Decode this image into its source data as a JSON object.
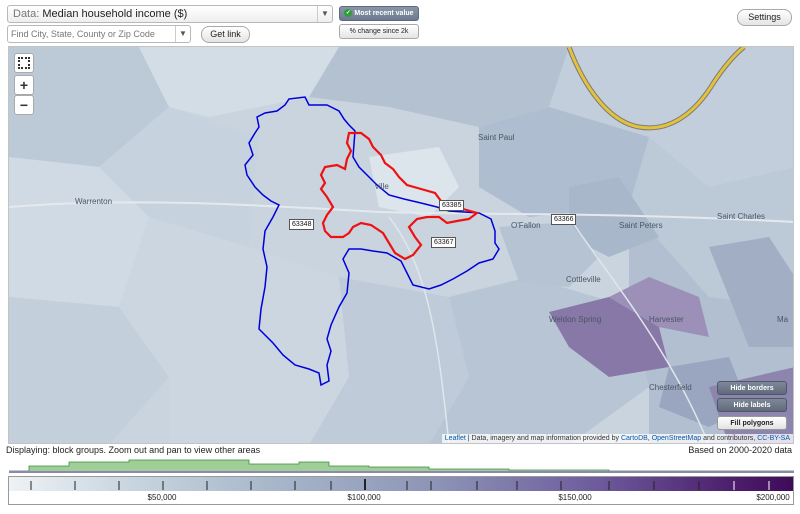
{
  "controls": {
    "data_prefix": "Data:",
    "data_value": "Median household income ($)",
    "find_placeholder": "Find City, State, County or Zip Code",
    "get_link": "Get link",
    "settings": "Settings",
    "most_recent": "Most recent value",
    "pct_change": "% change since 2k"
  },
  "map": {
    "places": [
      "Saint Paul",
      "Warrenton",
      "O'Fallon",
      "Saint Peters",
      "Saint Charles",
      "Cottleville",
      "Weldon Spring",
      "Harvester",
      "Chesterfield",
      "Ma",
      "ville"
    ],
    "zip_labels": [
      "63385",
      "63348",
      "63366",
      "63367"
    ],
    "map_buttons": {
      "hide_borders": "Hide borders",
      "hide_labels": "Hide labels",
      "fill_polygons": "Fill polygons"
    },
    "attribution": {
      "leaflet": "Leaflet",
      "text_1": "| Data, imagery and map information provided by",
      "carto": "CartoDB",
      "text_2": ",",
      "osm": "OpenStreetMap",
      "text_3": "and contributors,",
      "license": "CC-BY-SA"
    },
    "colors": {
      "red_boundary": "#ee1111",
      "blue_boundary": "#0000dd",
      "river": "#e3c23a"
    }
  },
  "footer": {
    "display_note": "Displaying: block groups. Zoom out and pan to view other areas",
    "based_on": "Based on 2000-2020 data"
  },
  "legend": {
    "labels": [
      "$50,000",
      "$100,000",
      "$150,000",
      "$200,000"
    ],
    "min": 0,
    "max": 205000
  }
}
